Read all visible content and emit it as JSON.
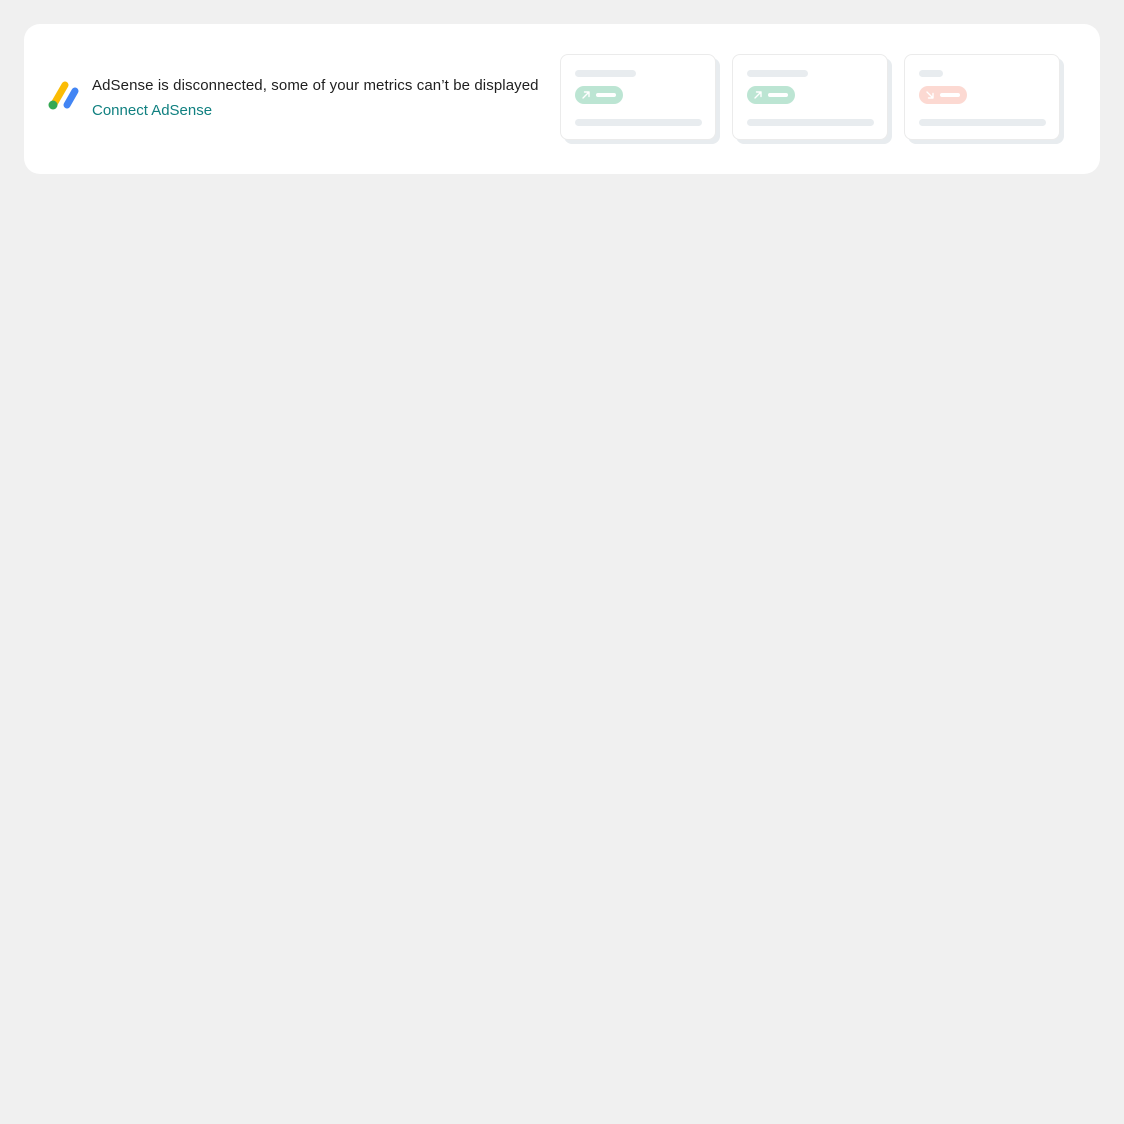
{
  "banner": {
    "logo_icon": "adsense-logo-icon",
    "message": "AdSense is disconnected, some of your metrics can’t be displayed",
    "connect_label": "Connect AdSense",
    "colors": {
      "link": "#108080",
      "logo_yellow": "#fbbc04",
      "logo_blue": "#4285f4",
      "logo_green": "#34a853"
    }
  },
  "preview_tiles": [
    {
      "trend": "up",
      "trend_icon": "arrow-up-right-icon",
      "color": "#bce5d3"
    },
    {
      "trend": "up",
      "trend_icon": "arrow-up-right-icon",
      "color": "#bce5d3"
    },
    {
      "trend": "down",
      "trend_icon": "arrow-down-right-icon",
      "color": "#fcd9d2"
    }
  ]
}
